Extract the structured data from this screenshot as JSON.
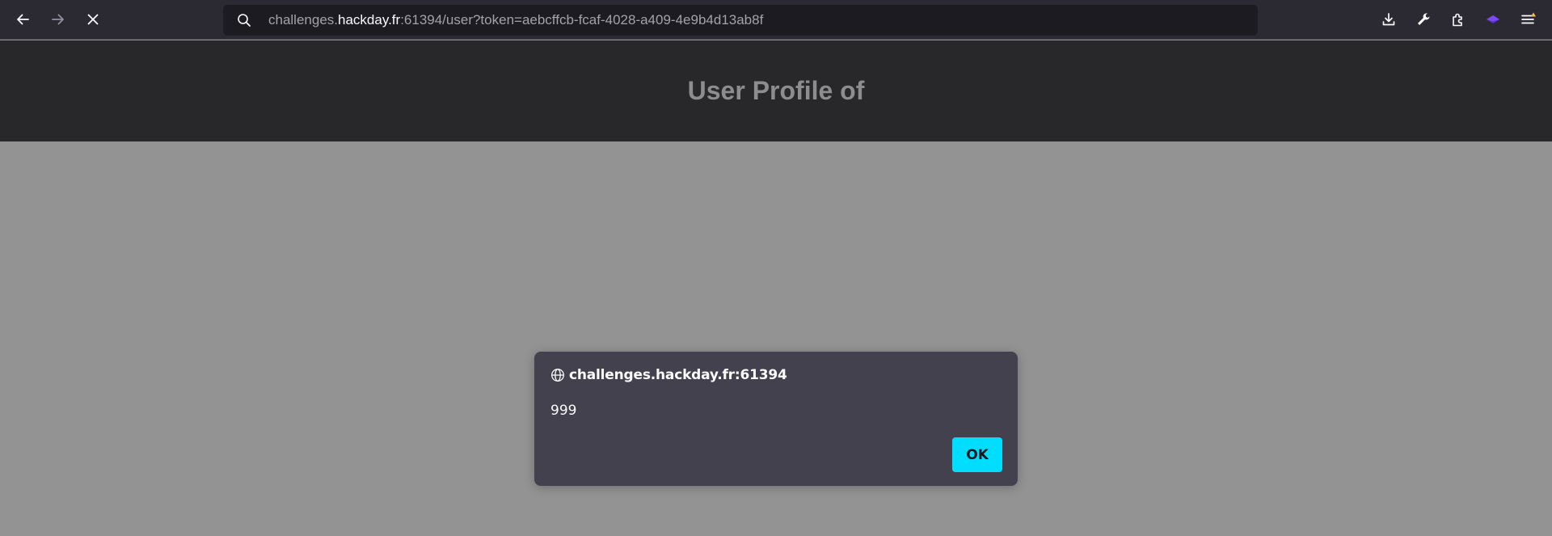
{
  "browser": {
    "url": {
      "prefix": "challenges.",
      "host": "hackday.fr",
      "suffix": ":61394/user?token=aebcffcb-fcaf-4028-a409-4e9b4d13ab8f"
    },
    "icons": {
      "back": "arrow-left-icon",
      "forward": "arrow-right-icon",
      "stop": "close-icon",
      "search": "search-icon",
      "downloads": "download-icon",
      "devtools": "wrench-icon",
      "extensions": "puzzle-icon",
      "extension": "purple-layers-icon",
      "menu": "hamburger-menu-icon"
    }
  },
  "page": {
    "title": "User Profile of"
  },
  "dialog": {
    "origin": "challenges.hackday.fr:61394",
    "message": "999",
    "ok_label": "OK"
  },
  "colors": {
    "toolbar": "#2b2a33",
    "urlbar": "#1c1b22",
    "header": "#28282a",
    "overlay": "#939394",
    "dialog": "#42414d",
    "accent": "#00ddff",
    "notification_badge": "#ffbd4f"
  }
}
